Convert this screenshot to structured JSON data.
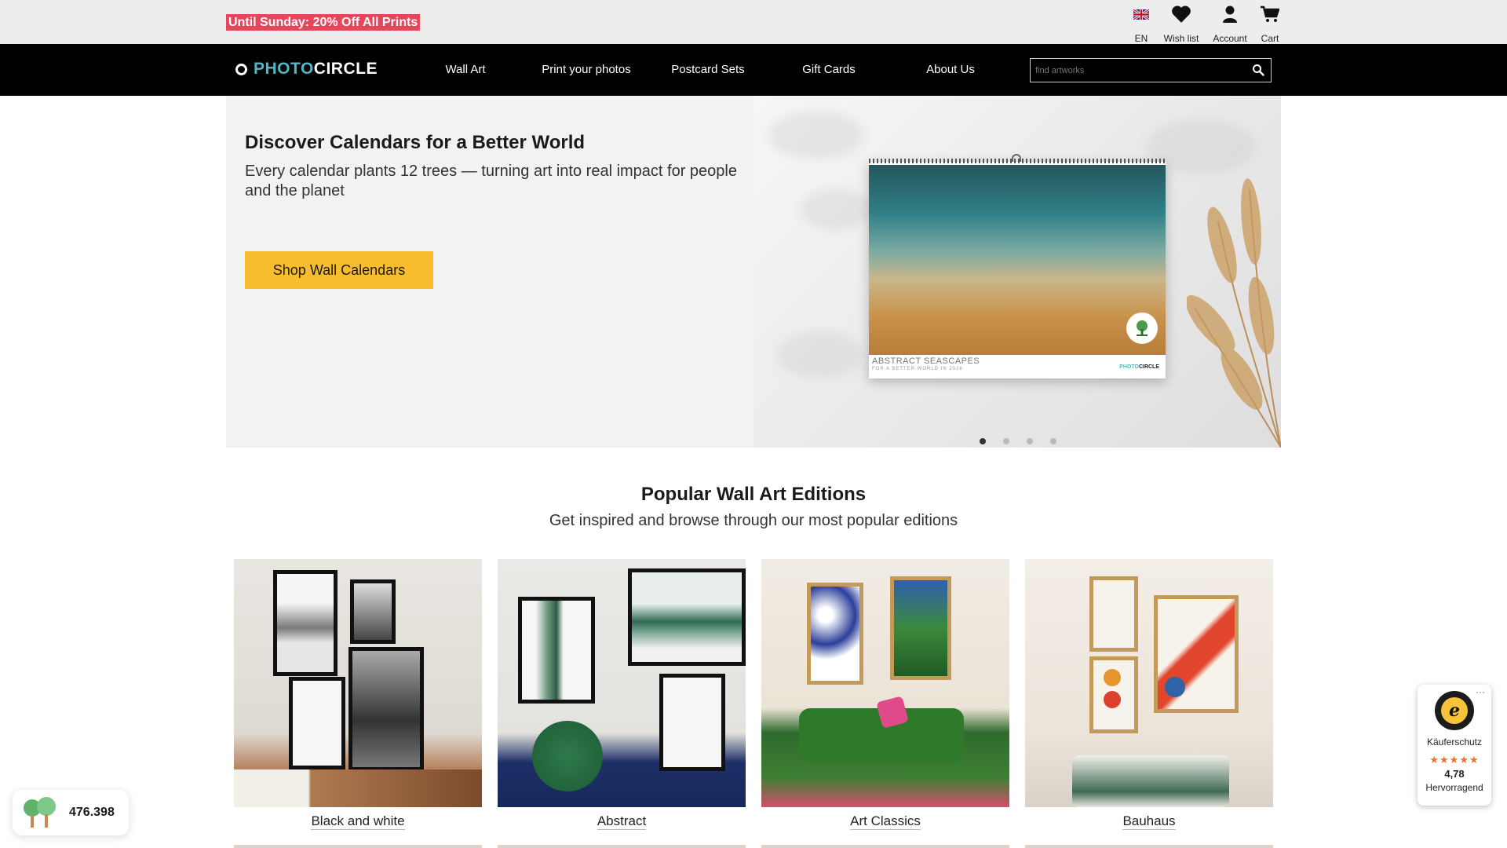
{
  "topbar": {
    "promo": "Until Sunday: 20% Off All Prints",
    "language": "EN",
    "wishlist": "Wish list",
    "account": "Account",
    "cart": "Cart"
  },
  "nav": {
    "logo_part1": "PHOTO",
    "logo_part2": "CIRCLE",
    "items": [
      "Wall Art",
      "Print your photos",
      "Postcard Sets",
      "Gift Cards",
      "About Us"
    ],
    "search_placeholder": "find artworks"
  },
  "hero": {
    "title": "Discover Calendars for a Better World",
    "subtitle": "Every calendar plants 12 trees — turning art into real impact for people and the planet",
    "button": "Shop Wall Calendars",
    "calendar_title": "ABSTRACT SEASCAPES",
    "calendar_subtitle": "FOR A BETTER WORLD IN 2026",
    "calendar_logo_part1": "PHOTO",
    "calendar_logo_part2": "CIRCLE",
    "slides_total": 4,
    "active_slide": 1
  },
  "section": {
    "title": "Popular Wall Art Editions",
    "subtitle": "Get inspired and browse through our most popular editions",
    "cards": [
      {
        "label": "Black and white"
      },
      {
        "label": "Abstract"
      },
      {
        "label": "Art Classics"
      },
      {
        "label": "Bauhaus"
      }
    ]
  },
  "trees": {
    "count": "476.398"
  },
  "trusted_shops": {
    "more": "···",
    "seal_letter": "e",
    "label": "Käuferschutz",
    "stars": "★★★★★",
    "rating": "4,78",
    "verdict": "Hervorragend"
  },
  "colors": {
    "promo_bg": "#e8455a",
    "nav_bg": "#000000",
    "logo_accent": "#4fb7c4",
    "cta": "#f7bd2e",
    "stars": "#e8742a"
  }
}
